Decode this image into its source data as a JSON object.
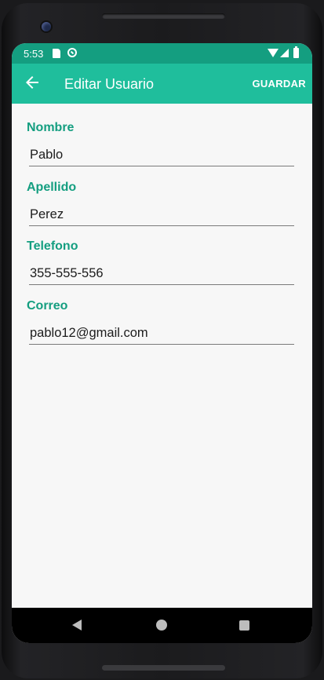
{
  "status_bar": {
    "time": "5:53",
    "icons": [
      "sd-card-icon",
      "sync-icon",
      "wifi-icon",
      "signal-icon",
      "battery-icon"
    ]
  },
  "app_bar": {
    "title": "Editar Usuario",
    "back_icon": "arrow-left-icon",
    "save_label": "GUARDAR"
  },
  "form": {
    "fields": [
      {
        "label": "Nombre",
        "value": "Pablo"
      },
      {
        "label": "Apellido",
        "value": "Perez"
      },
      {
        "label": "Telefono",
        "value": "355-555-556"
      },
      {
        "label": "Correo",
        "value": "pablo12@gmail.com"
      }
    ]
  },
  "nav_bar": {
    "icons": [
      "nav-back-icon",
      "nav-home-icon",
      "nav-recents-icon"
    ]
  },
  "colors": {
    "status_bar": "#149e80",
    "app_bar": "#1fbe9c",
    "label": "#149e80",
    "background": "#f7f7f7"
  }
}
